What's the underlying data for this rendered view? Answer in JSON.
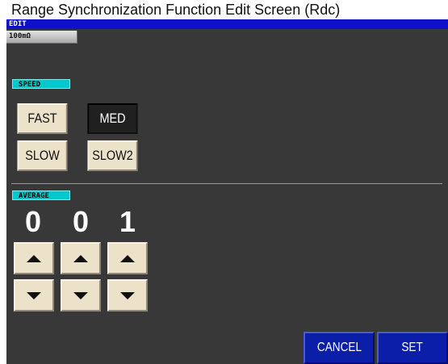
{
  "caption": "Range Synchronization Function Edit Screen (Rdc)",
  "screen": {
    "title": "EDIT",
    "range_tab": "100mΩ"
  },
  "speed": {
    "label": "SPEED",
    "options": [
      "FAST",
      "MED",
      "SLOW",
      "SLOW2"
    ],
    "selected": "MED"
  },
  "average": {
    "label": "AVERAGE",
    "digits": [
      "0",
      "0",
      "1"
    ]
  },
  "actions": {
    "cancel": "CANCEL",
    "set": "SET"
  },
  "colors": {
    "title_bar": "#1010c8",
    "section_label": "#00c8cc",
    "button_face": "#ece2ca",
    "selected_button": "#202020",
    "action_button": "#0a1ea8",
    "screen_background": "#383838"
  },
  "icons": {
    "increment": "triangle-up",
    "decrement": "triangle-down"
  }
}
